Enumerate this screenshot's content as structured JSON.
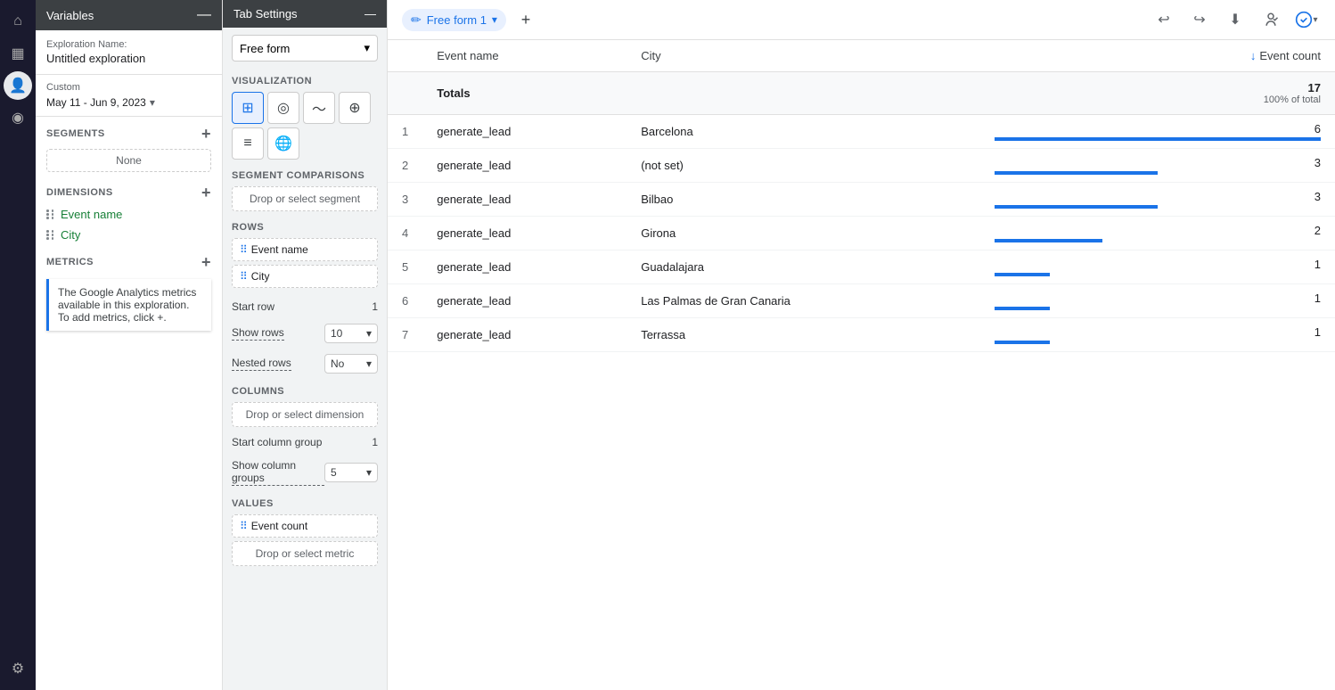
{
  "leftNav": {
    "icons": [
      {
        "name": "home-icon",
        "symbol": "⌂",
        "active": false
      },
      {
        "name": "chart-icon",
        "symbol": "📊",
        "active": false
      },
      {
        "name": "people-icon",
        "symbol": "👤",
        "active": true
      },
      {
        "name": "tag-icon",
        "symbol": "◎",
        "active": false
      }
    ],
    "bottomIcons": [
      {
        "name": "settings-icon",
        "symbol": "⚙",
        "active": false
      }
    ]
  },
  "variablesPanel": {
    "title": "Variables",
    "explorationLabel": "Exploration Name:",
    "explorationValue": "Untitled exploration",
    "dateLabel": "Custom",
    "dateValue": "May 11 - Jun 9, 2023",
    "segments": {
      "label": "SEGMENTS",
      "value": "None"
    },
    "dimensions": {
      "label": "DIMENSIONS",
      "items": [
        {
          "label": "Event name",
          "color": "green"
        },
        {
          "label": "City",
          "color": "green"
        }
      ]
    },
    "metrics": {
      "label": "METRICS",
      "tooltip": "The Google Analytics metrics available in this exploration. To add metrics, click +."
    }
  },
  "tabSettings": {
    "title": "Tab Settings",
    "technique": "Free form",
    "visualization": {
      "label": "VISUALIZATION",
      "icons": [
        {
          "name": "table-viz-icon",
          "symbol": "⊞",
          "active": true
        },
        {
          "name": "donut-viz-icon",
          "symbol": "◎",
          "active": false
        },
        {
          "name": "line-viz-icon",
          "symbol": "〜",
          "active": false
        },
        {
          "name": "scatter-viz-icon",
          "symbol": "⊕",
          "active": false
        },
        {
          "name": "bar-viz-icon",
          "symbol": "≡",
          "active": false
        },
        {
          "name": "map-viz-icon",
          "symbol": "🌐",
          "active": false
        }
      ]
    },
    "segmentComparisons": {
      "label": "SEGMENT COMPARISONS",
      "placeholder": "Drop or select segment"
    },
    "rows": {
      "label": "ROWS",
      "items": [
        {
          "label": "Event name"
        },
        {
          "label": "City"
        }
      ]
    },
    "startRow": {
      "label": "Start row",
      "value": "1"
    },
    "showRows": {
      "label": "Show rows",
      "value": "10"
    },
    "nestedRows": {
      "label": "Nested rows",
      "value": "No"
    },
    "columns": {
      "label": "COLUMNS",
      "placeholder": "Drop or select dimension"
    },
    "startColumnGroup": {
      "label": "Start column group",
      "value": "1"
    },
    "showColumnGroups": {
      "label": "Show column groups",
      "value": "5"
    },
    "values": {
      "label": "VALUES",
      "items": [
        {
          "label": "Event count"
        }
      ],
      "placeholder": "Drop or select metric"
    }
  },
  "mainTab": {
    "name": "Free form 1",
    "addTabLabel": "+"
  },
  "toolbar": {
    "undoLabel": "↩",
    "redoLabel": "↪",
    "downloadLabel": "⬇",
    "shareLabel": "👤",
    "checkLabel": "✓"
  },
  "table": {
    "columns": [
      {
        "key": "rownum",
        "label": ""
      },
      {
        "key": "eventname",
        "label": "Event name"
      },
      {
        "key": "city",
        "label": "City"
      },
      {
        "key": "eventcount",
        "label": "↓ Event count",
        "sorted": true
      }
    ],
    "totals": {
      "label": "Totals",
      "eventcount": "17",
      "subtitle": "100% of total"
    },
    "rows": [
      {
        "num": 1,
        "eventname": "generate_lead",
        "city": "Barcelona",
        "eventcount": 6,
        "pct": 100
      },
      {
        "num": 2,
        "eventname": "generate_lead",
        "city": "(not set)",
        "eventcount": 3,
        "pct": 50
      },
      {
        "num": 3,
        "eventname": "generate_lead",
        "city": "Bilbao",
        "eventcount": 3,
        "pct": 50
      },
      {
        "num": 4,
        "eventname": "generate_lead",
        "city": "Girona",
        "eventcount": 2,
        "pct": 33
      },
      {
        "num": 5,
        "eventname": "generate_lead",
        "city": "Guadalajara",
        "eventcount": 1,
        "pct": 17
      },
      {
        "num": 6,
        "eventname": "generate_lead",
        "city": "Las Palmas de Gran Canaria",
        "eventcount": 1,
        "pct": 17
      },
      {
        "num": 7,
        "eventname": "generate_lead",
        "city": "Terrassa",
        "eventcount": 1,
        "pct": 17
      }
    ]
  }
}
